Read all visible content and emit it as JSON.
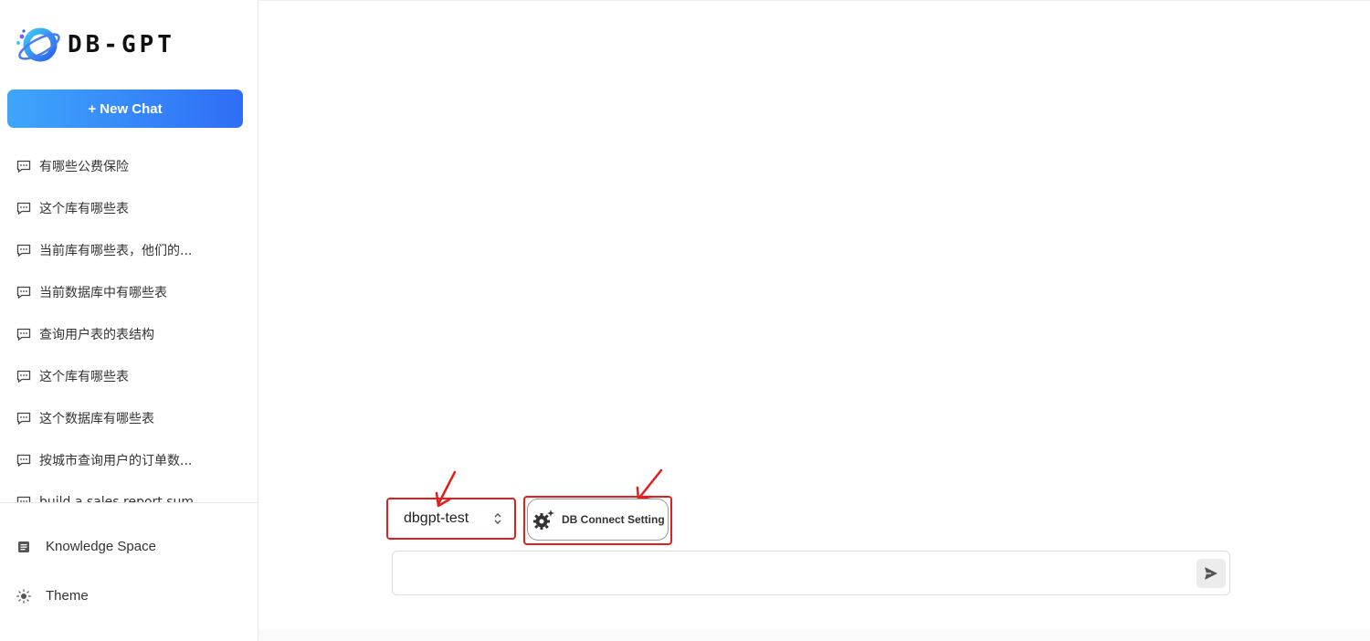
{
  "brand": {
    "name": "DB-GPT"
  },
  "sidebar": {
    "new_chat_label": "+ New Chat",
    "history": [
      {
        "label": "有哪些公费保险"
      },
      {
        "label": "这个库有哪些表"
      },
      {
        "label": "当前库有哪些表，他们的..."
      },
      {
        "label": "当前数据库中有哪些表"
      },
      {
        "label": "查询用户表的表结构"
      },
      {
        "label": "这个库有哪些表"
      },
      {
        "label": "这个数据库有哪些表"
      },
      {
        "label": "按城市查询用户的订单数..."
      },
      {
        "label": "build a sales report sum..."
      }
    ],
    "links": {
      "knowledge": {
        "label": "Knowledge Space",
        "icon": "document-icon"
      },
      "theme": {
        "label": "Theme",
        "icon": "sun-icon"
      }
    }
  },
  "main": {
    "db_select": {
      "value": "dbgpt-test"
    },
    "db_setting": {
      "label": "DB Connect Setting",
      "icon": "gears-icon"
    },
    "input": {
      "placeholder": "",
      "value": ""
    },
    "send": {
      "icon": "send-icon"
    }
  },
  "colors": {
    "accent_start": "#3fa6fb",
    "accent_end": "#2f6df6",
    "highlight_red": "#e41d1d"
  }
}
